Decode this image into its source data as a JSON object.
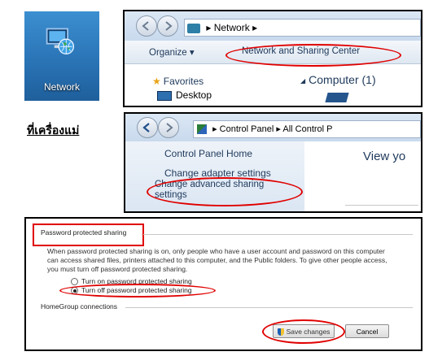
{
  "desktop": {
    "icon_label": "Network",
    "icon_name": "network-globe-icon",
    "caption": "ที่เครื่องแม่"
  },
  "explorer": {
    "address": "Network",
    "address_sep": "▸",
    "organize_label": "Organize ▾",
    "network_sharing_center_label": "Network and Sharing Center",
    "favorites_label": "Favorites",
    "desktop_label": "Desktop",
    "computer_group_label": "Computer (1)"
  },
  "control_panel": {
    "address_part1": "Control Panel",
    "address_part2": "All Control P",
    "home_link": "Control Panel Home",
    "adapter_link": "Change adapter settings",
    "advanced_link": "Change advanced sharing settings",
    "view_heading": "View yo"
  },
  "sharing": {
    "section_title": "Password protected sharing",
    "description": "When password protected sharing is on, only people who have a user account and password on this computer can access shared files, printers attached to this computer, and the Public folders. To give other people access, you must turn off password protected sharing.",
    "option_on": "Turn on password protected sharing",
    "option_off": "Turn off password protected sharing",
    "homegroup_title": "HomeGroup connections",
    "save_button": "Save changes",
    "cancel_button": "Cancel"
  },
  "colors": {
    "highlight_red": "#e00000",
    "desktop_blue": "#2a74b6",
    "link_navy": "#1e395b"
  }
}
